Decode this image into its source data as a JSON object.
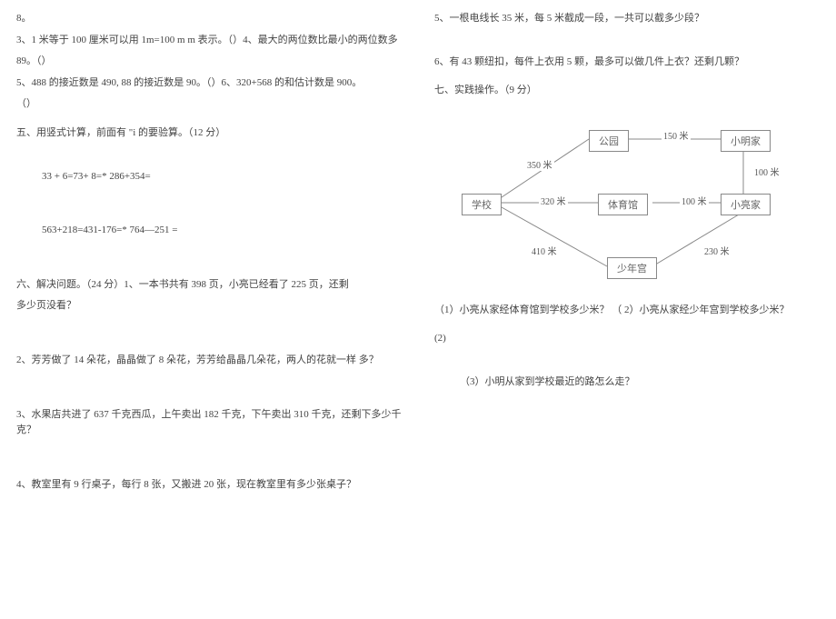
{
  "left": {
    "p1": "8。",
    "p2": "3、1 米等于 100 厘米可以用 1m=100 m m 表示。（）4、最大的两位数比最小的两位数多",
    "p3": "89。（）",
    "p4": "5、488 的接近数是 490, 88 的接近数是 90。（）6、320+568 的和估计数是 900。",
    "p5": "（）",
    "section5": "五、用竖式计算，前面有 \"i 的要验算。（12 分）",
    "eq1": "33 + 6=73+ 8=* 286+354=",
    "eq2": "563+218=431-176=* 764—251 =",
    "section6": "六、解决问题。（24 分）1、一本书共有 398 页，小亮已经看了 225 页，还剩",
    "section6b": "多少页没看？",
    "q2": "2、芳芳做了 14 朵花，晶晶做了 8 朵花，芳芳给晶晶几朵花，两人的花就一样 多？",
    "q3": "3、水果店共进了 637 千克西瓜，上午卖出 182 千克，下午卖出 310 千克，还剩下多少千克？",
    "q4": "4、教室里有 9 行桌子，每行 8 张，又搬进 20 张，现在教室里有多少张桌子？"
  },
  "right": {
    "q5": "5、一根电线长 35 米，每 5 米截成一段，一共可以截多少段？",
    "q6": "6、有 43 颗纽扣，每件上衣用 5 颗，最多可以做几件上衣？还剩几颗？",
    "section7": "七、实践操作。（9 分）",
    "nodes": {
      "school": "学校",
      "park": "公园",
      "gym": "体育馆",
      "xiaoming": "小明家",
      "xiaoliang": "小亮家",
      "youth": "少年宫"
    },
    "dist": {
      "d350": "350 米",
      "d150": "150 米",
      "d100a": "100 米",
      "d320": "320 米",
      "d100b": "100 米",
      "d410": "410 米",
      "d230": "230 米"
    },
    "sub1": "（1）小亮从家经体育馆到学校多少米？ （ 2）小亮从家经少年宫到学校多少米？",
    "sub2": "(2)",
    "sub3": "（3）小明从家到学校最近的路怎么走？"
  },
  "chart_data": {
    "type": "diagram",
    "nodes": [
      "学校",
      "公园",
      "体育馆",
      "小明家",
      "小亮家",
      "少年宫"
    ],
    "edges": [
      {
        "from": "学校",
        "to": "公园",
        "dist_m": 350
      },
      {
        "from": "公园",
        "to": "小明家",
        "dist_m": 150
      },
      {
        "from": "小明家",
        "to": "小亮家",
        "dist_m": 100
      },
      {
        "from": "学校",
        "to": "体育馆",
        "dist_m": 320
      },
      {
        "from": "体育馆",
        "to": "小亮家",
        "dist_m": 100
      },
      {
        "from": "学校",
        "to": "少年宫",
        "dist_m": 410
      },
      {
        "from": "少年宫",
        "to": "小亮家",
        "dist_m": 230
      }
    ]
  }
}
